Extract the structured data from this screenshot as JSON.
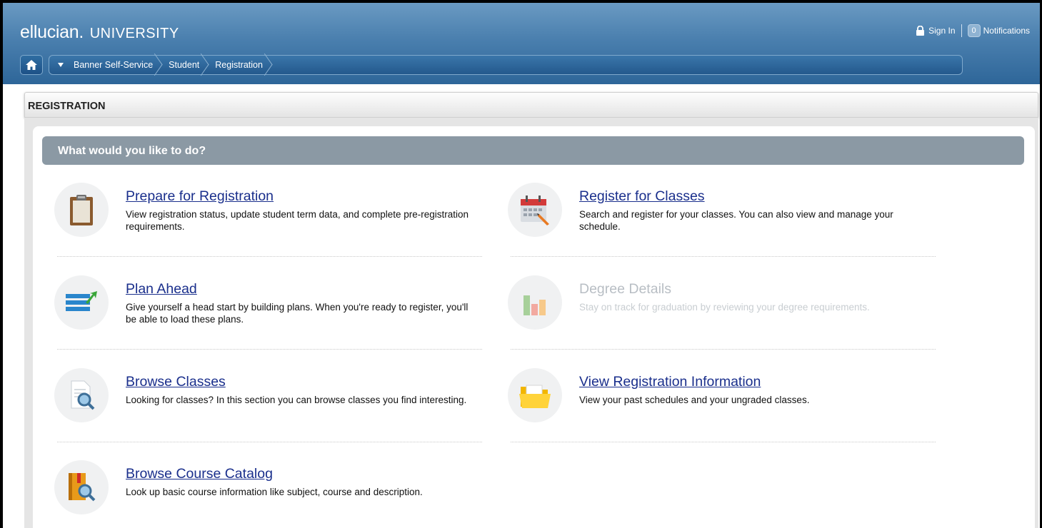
{
  "header": {
    "brand": "ellucian",
    "dot": ".",
    "university": "UNIVERSITY",
    "sign_in": "Sign In",
    "notifications_count": "0",
    "notifications_label": "Notifications"
  },
  "breadcrumb": {
    "items": [
      "Banner Self-Service",
      "Student",
      "Registration"
    ]
  },
  "page": {
    "section_title": "REGISTRATION",
    "panel_title": "What would you like to do?"
  },
  "actions": [
    {
      "title": "Prepare for Registration",
      "desc": "View registration status, update student term data, and complete pre-registration requirements.",
      "icon": "clipboard-icon",
      "enabled": true
    },
    {
      "title": "Register for Classes",
      "desc": "Search and register for your classes. You can also view and manage your schedule.",
      "icon": "calendar-icon",
      "enabled": true
    },
    {
      "title": "Plan Ahead",
      "desc": "Give yourself a head start by building plans. When you're ready to register, you'll be able to load these plans.",
      "icon": "plan-list-icon",
      "enabled": true
    },
    {
      "title": "Degree Details",
      "desc": "Stay on track for graduation by reviewing your degree requirements.",
      "icon": "bar-chart-icon",
      "enabled": false
    },
    {
      "title": "Browse Classes",
      "desc": "Looking for classes? In this section you can browse classes you find interesting.",
      "icon": "magnify-document-icon",
      "enabled": true
    },
    {
      "title": "View Registration Information",
      "desc": "View your past schedules and your ungraded classes.",
      "icon": "folder-icon",
      "enabled": true
    },
    {
      "title": "Browse Course Catalog",
      "desc": "Look up basic course information like subject, course and description.",
      "icon": "book-search-icon",
      "enabled": true
    }
  ],
  "colors": {
    "header_top": "#6a9ac2",
    "header_bottom": "#2e6699",
    "link": "#1a2f8c",
    "panel_header": "#8b99a4",
    "disabled_text": "#b8bec4"
  }
}
